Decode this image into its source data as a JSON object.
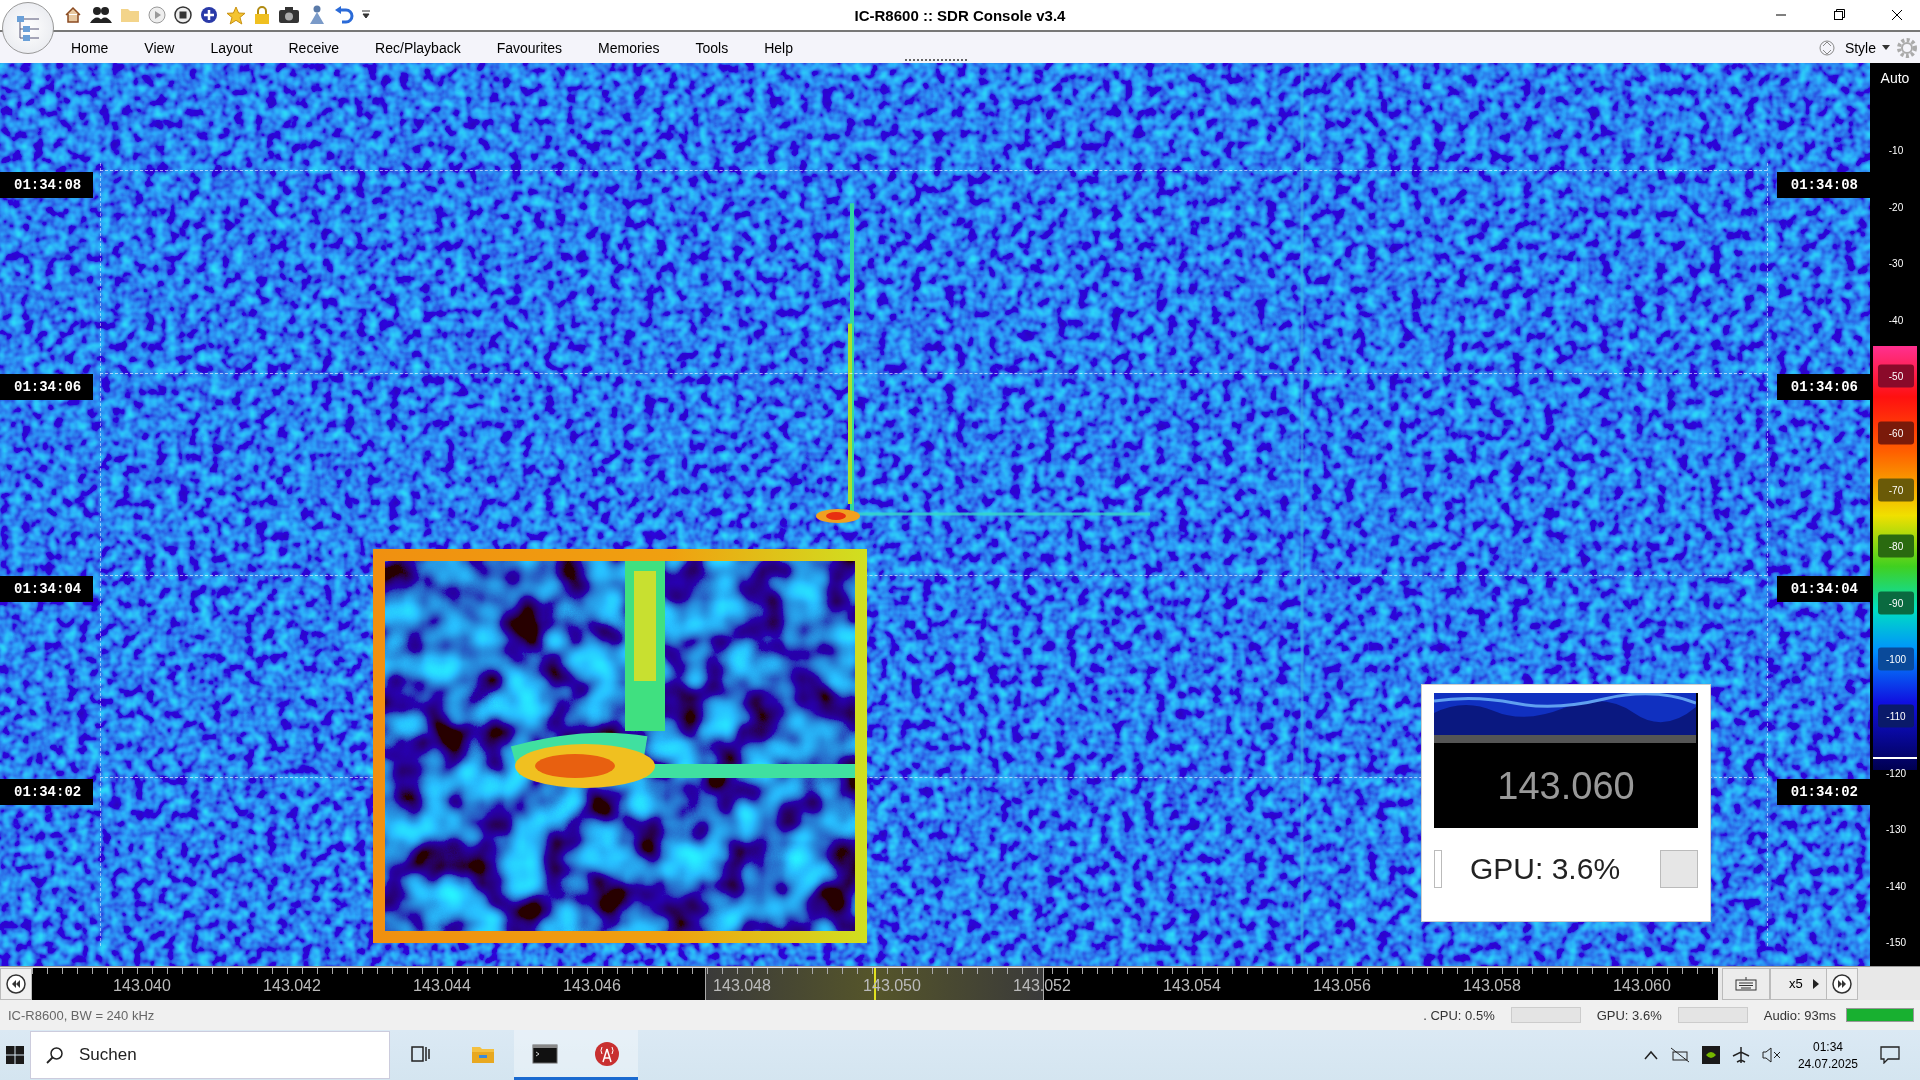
{
  "window": {
    "title": "IC-R8600 :: SDR Console v3.4"
  },
  "menu": [
    "Home",
    "View",
    "Layout",
    "Receive",
    "Rec/Playback",
    "Favourites",
    "Memories",
    "Tools",
    "Help"
  ],
  "style_menu": {
    "label": "Style"
  },
  "waterfall": {
    "time_labels_left": [
      "01:34:08",
      "01:34:06",
      "01:34:04",
      "01:34:02"
    ],
    "time_labels_right": [
      "01:34:08",
      "01:34:06",
      "01:34:04",
      "01:34:02"
    ]
  },
  "scale": {
    "mode": "Auto",
    "ticks": [
      {
        "label": "-10"
      },
      {
        "label": "-20"
      },
      {
        "label": "-30"
      },
      {
        "label": "-40"
      },
      {
        "label": "-50",
        "color": "#8a0a2a"
      },
      {
        "label": "-60",
        "color": "#7a1a0a"
      },
      {
        "label": "-70",
        "color": "#6a5a08"
      },
      {
        "label": "-80",
        "color": "#2a6a10"
      },
      {
        "label": "-90",
        "color": "#0a6a40"
      },
      {
        "label": "-100",
        "color": "#0a4a9a"
      },
      {
        "label": "-110",
        "color": "#0a1a6a"
      },
      {
        "label": "-120"
      },
      {
        "label": "-130"
      },
      {
        "label": "-140"
      },
      {
        "label": "-150"
      }
    ]
  },
  "mini_display": {
    "frequency": "143.060",
    "gpu": "GPU: 3.6%"
  },
  "frequency_axis": {
    "labels": [
      "143.040",
      "143.042",
      "143.044",
      "143.046",
      "143.048",
      "143.050",
      "143.052",
      "143.054",
      "143.056",
      "143.058",
      "143.060"
    ],
    "zoom": "x5"
  },
  "status_bar": {
    "device": "IC-R8600, BW = 240 kHz",
    "cpu": ". CPU: 0.5%",
    "gpu": "GPU: 3.6%",
    "audio": "Audio: 93ms",
    "audio_meter": {
      "level": 1
    }
  },
  "taskbar": {
    "search_placeholder": "Suchen",
    "apps": [
      {
        "kind": "taskview",
        "selected": false
      },
      {
        "kind": "folder",
        "selected": false
      },
      {
        "kind": "terminal",
        "selected": true
      },
      {
        "kind": "radio",
        "selected": true
      }
    ],
    "time": "01:34",
    "date": "24.07.2025"
  }
}
